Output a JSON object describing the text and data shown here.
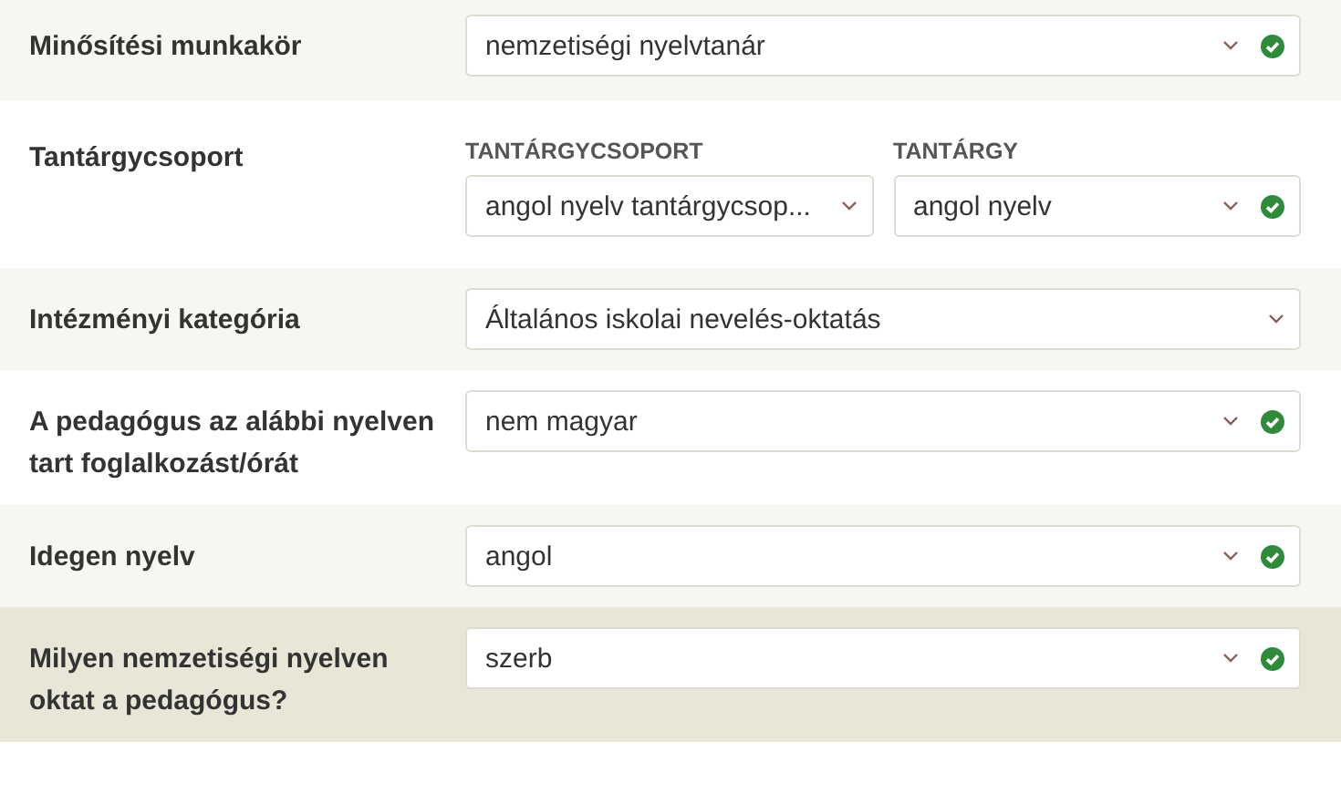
{
  "rows": [
    {
      "label": "Minősítési munkakör",
      "highlighted": false,
      "fields": [
        {
          "value": "nemzetiségi nyelvtanár",
          "valid": true
        }
      ]
    },
    {
      "label": "Tantárgycsoport",
      "highlighted": false,
      "fields": [
        {
          "caption": "TANTÁRGYCSOPORT",
          "value": "angol nyelv tantárgycsop...",
          "valid": false
        },
        {
          "caption": "TANTÁRGY",
          "value": "angol nyelv",
          "valid": true
        }
      ]
    },
    {
      "label": "Intézményi kategória",
      "highlighted": false,
      "fields": [
        {
          "value": "Általános iskolai nevelés-oktatás",
          "valid": false
        }
      ]
    },
    {
      "label": "A pedagógus az alábbi nyelven tart foglalkozást/órát",
      "highlighted": false,
      "fields": [
        {
          "value": "nem magyar",
          "valid": true
        }
      ]
    },
    {
      "label": "Idegen nyelv",
      "highlighted": false,
      "fields": [
        {
          "value": "angol",
          "valid": true
        }
      ]
    },
    {
      "label": "Milyen nemzetiségi nyelven oktat a pedagógus?",
      "highlighted": true,
      "fields": [
        {
          "value": "szerb",
          "valid": true
        }
      ]
    }
  ]
}
